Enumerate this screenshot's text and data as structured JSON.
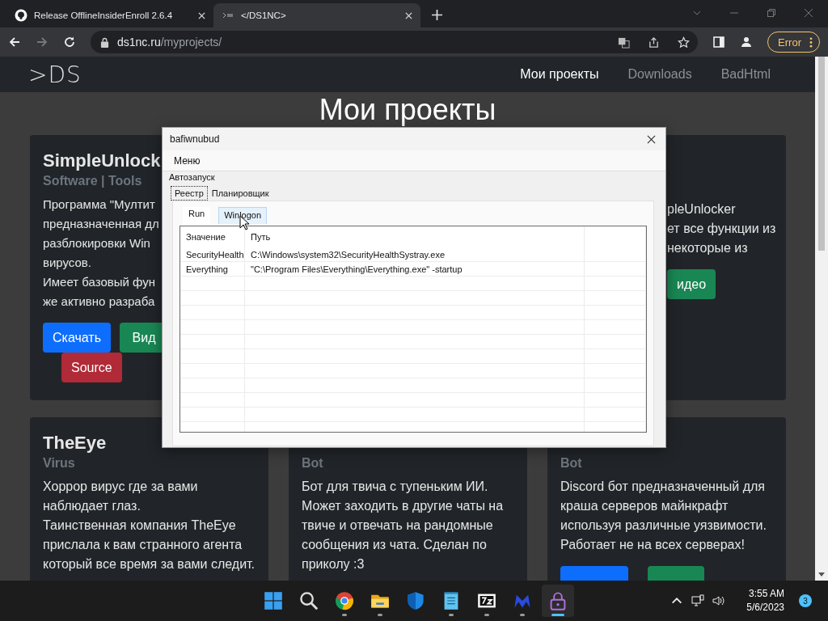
{
  "browser": {
    "tabs": [
      {
        "title": "Release OfflineInsiderEnroll 2.6.4",
        "selected": false,
        "kind": "github"
      },
      {
        "title": "</DS1NC>",
        "selected": true,
        "kind": "site"
      }
    ],
    "forward_disabled": true,
    "url_host": "ds1nc.ru",
    "url_path": "/myprojects/",
    "profile_button": "Error"
  },
  "site": {
    "logo": ">DS",
    "nav": [
      {
        "label": "Мои проекты",
        "selected": true
      },
      {
        "label": "Downloads",
        "selected": false
      },
      {
        "label": "BadHtml",
        "selected": false
      }
    ],
    "heading": "Мои проекты",
    "top_cards": [
      {
        "title": "SimpleUnlock",
        "subtitle": "Software | Tools",
        "covered": false,
        "lines": [
          "Программа \"Мултит",
          "предназначенная дл",
          "разблокировки Win",
          "вирусов.",
          "Имеет базовый фун",
          "же активно разраба"
        ],
        "buttons": [
          {
            "label": "Скачать",
            "kind": "primary"
          },
          {
            "label": "Вид",
            "kind": "success"
          },
          {
            "label": "Source",
            "kind": "danger"
          }
        ]
      },
      {
        "covered": true,
        "lines": [
          "pleUnlocker",
          "ет все функции из",
          "некоторые из"
        ],
        "buttons": [
          {
            "label": "идео",
            "kind": "success"
          }
        ]
      }
    ],
    "bottom_cards": [
      {
        "title": "TheEye",
        "subtitle": "Virus",
        "lines": [
          "Хоррор вирус где за вами",
          "наблюдает глаз.",
          "Таинственная компания TheEye",
          "прислала к вам странного агента",
          "который все время за вами следит."
        ]
      },
      {
        "subtitle": "Bot",
        "lines": [
          "Бот для твича с тупеньким ИИ.",
          "Может заходить в другие чаты на",
          "твиче и отвечать на рандомные",
          "сообщения из чата. Сделан по",
          "приколу :3"
        ]
      },
      {
        "subtitle": "Bot",
        "lines": [
          "Discord бот предназначенный для",
          "краша серверов майнкрафт",
          "используя различные уязвимости.",
          "Работает не на всех серверах!"
        ],
        "buttons": [
          {
            "kind": "primary"
          },
          {
            "kind": "success"
          }
        ]
      }
    ]
  },
  "dialog": {
    "title": "bafiwnubud",
    "menu": [
      "Меню"
    ],
    "group": "Автозапуск",
    "tabs": [
      {
        "label": "Реестр",
        "selected": true
      },
      {
        "label": "Планировщик",
        "selected": false
      }
    ],
    "subtabs": [
      {
        "label": "Run",
        "selected": true,
        "hovered": false
      },
      {
        "label": "Winlogon",
        "selected": false,
        "hovered": true
      }
    ],
    "columns": [
      "Значение",
      "Путь"
    ],
    "rows": [
      [
        "SecurityHealth",
        "C:\\Windows\\system32\\SecurityHealthSystray.exe"
      ],
      [
        "Everything",
        "\"C:\\Program Files\\Everything\\Everything.exe\" -startup"
      ]
    ]
  },
  "taskbar": {
    "apps": [
      {
        "kind": "windows",
        "running": false,
        "active": false
      },
      {
        "kind": "search",
        "running": false,
        "active": false
      },
      {
        "kind": "chrome",
        "running": true,
        "active": false
      },
      {
        "kind": "folder",
        "running": true,
        "active": false
      },
      {
        "kind": "shield",
        "running": false,
        "active": false
      },
      {
        "kind": "notepad",
        "running": true,
        "active": false
      },
      {
        "kind": "archive",
        "running": true,
        "active": false
      },
      {
        "kind": "m-logo",
        "running": true,
        "active": false
      },
      {
        "kind": "lock",
        "running": true,
        "active": true
      }
    ],
    "time": "3:55 AM",
    "date": "5/6/2023",
    "notifications": "3"
  }
}
